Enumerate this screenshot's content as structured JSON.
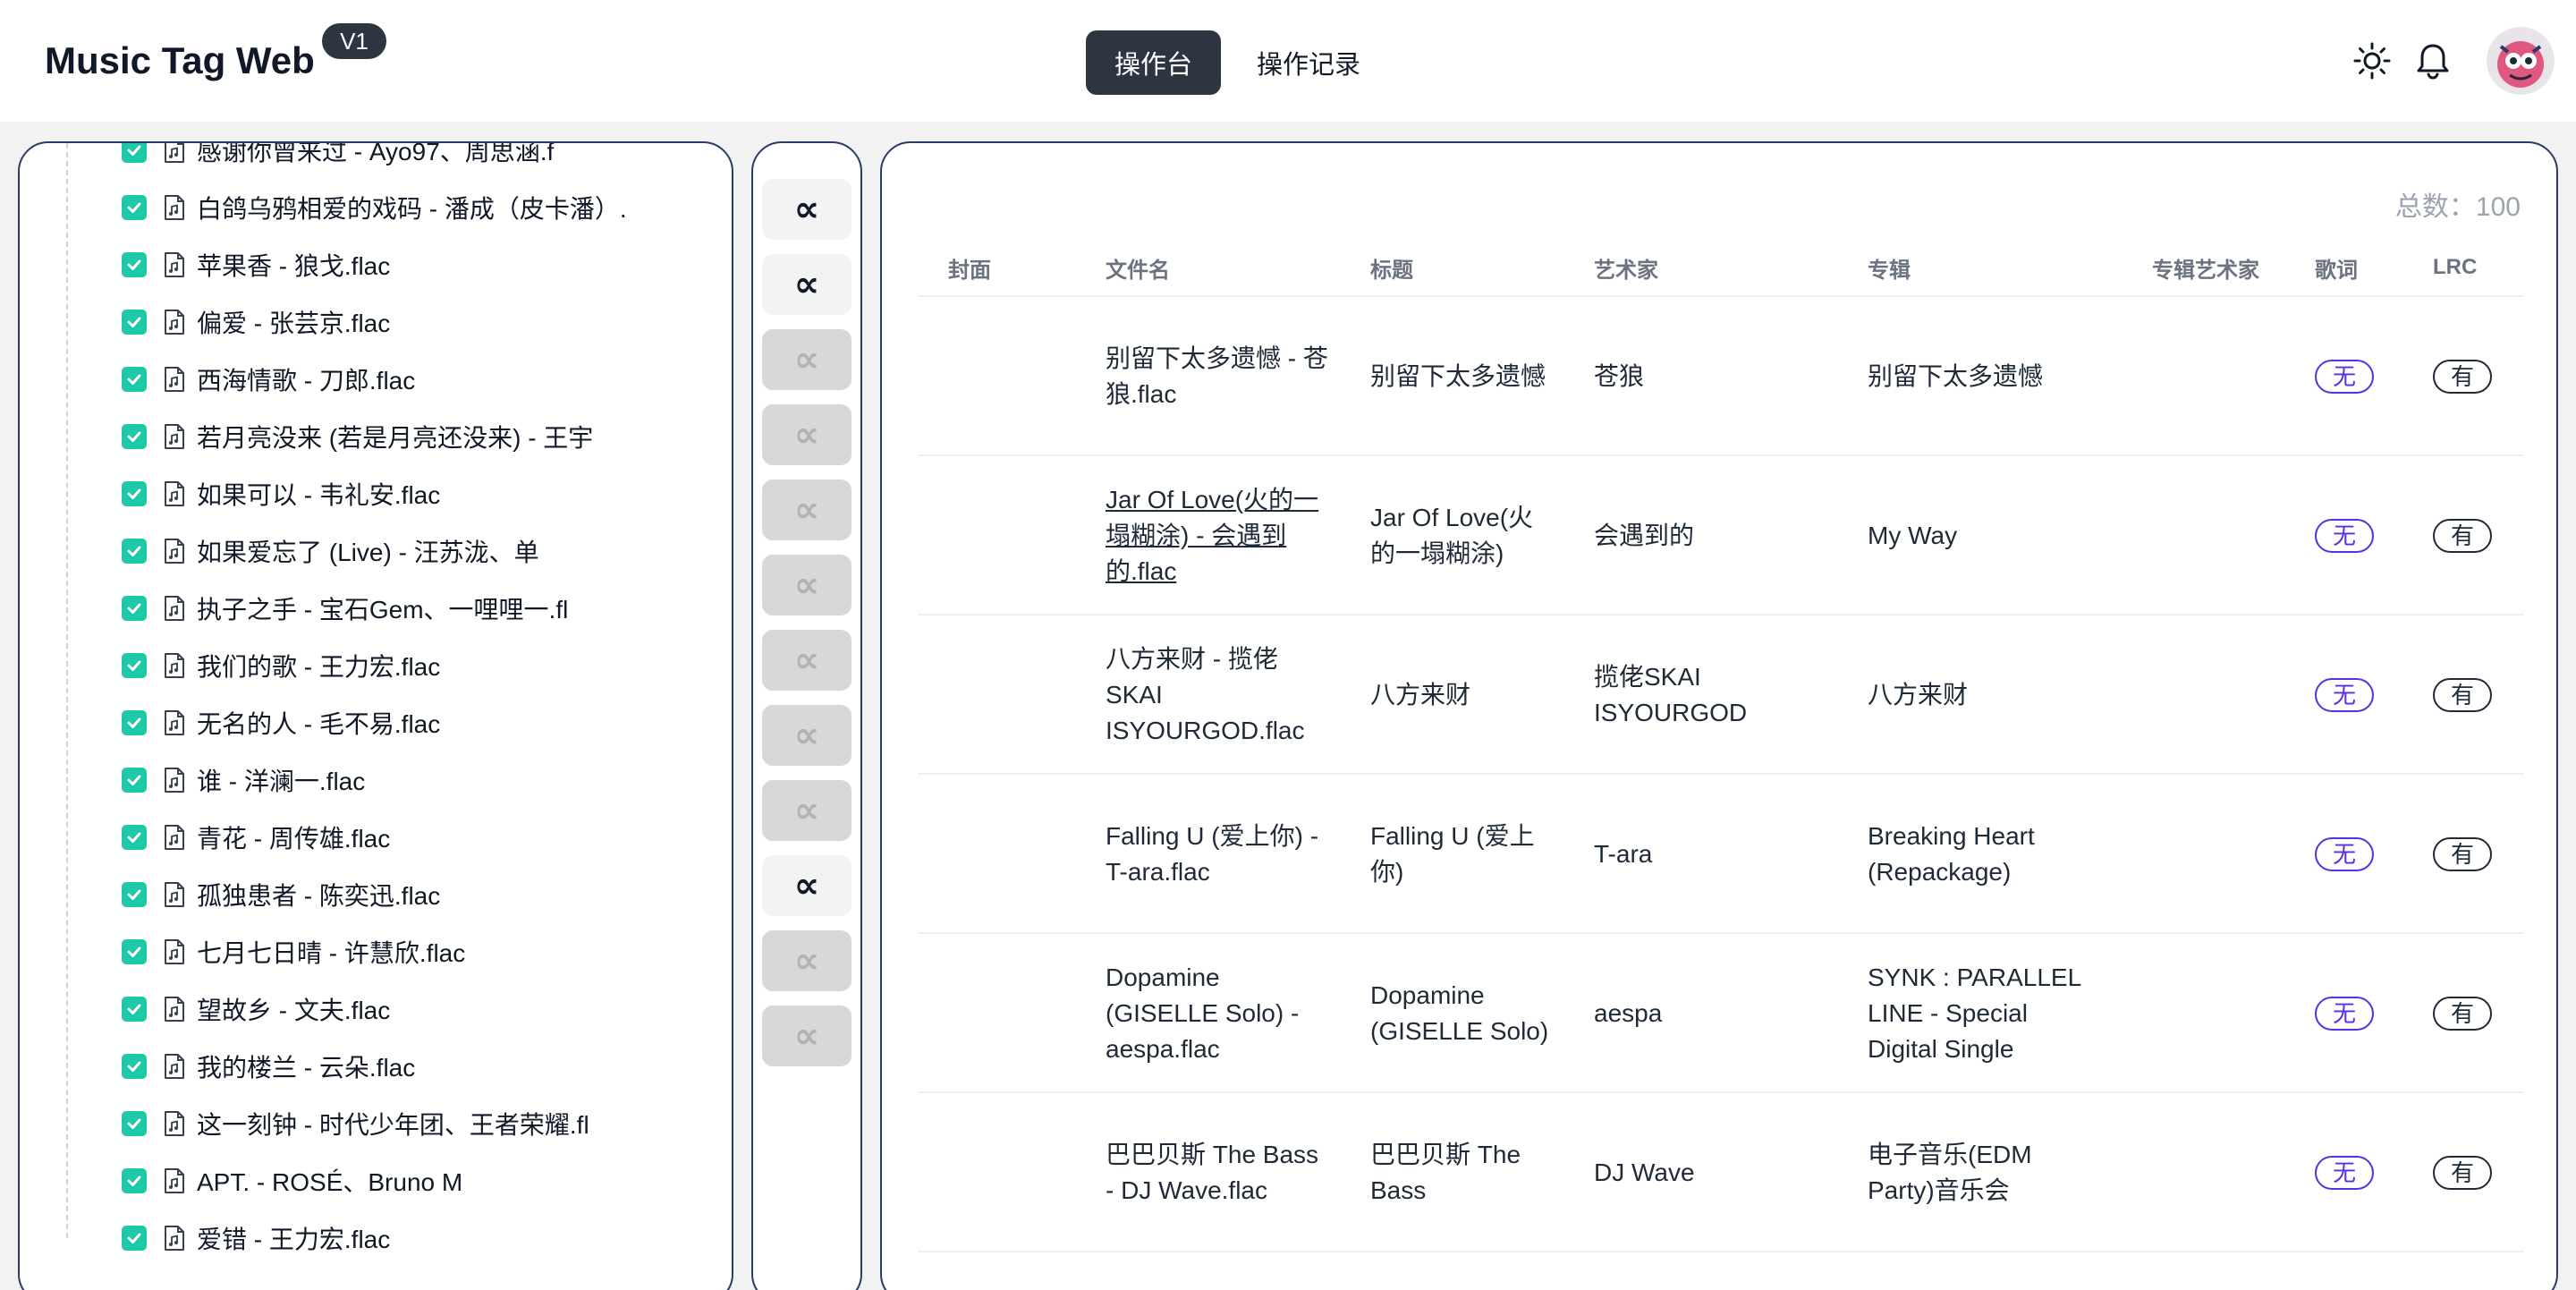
{
  "header": {
    "brand": "Music Tag Web",
    "version": "V1",
    "tabs": [
      {
        "label": "操作台",
        "active": true
      },
      {
        "label": "操作记录",
        "active": false
      }
    ]
  },
  "tree": {
    "items": [
      "感谢你曾来过 - Ayo97、周思涵.f",
      "白鸽乌鸦相爱的戏码 - 潘成（皮卡潘）.",
      "苹果香 - 狼戈.flac",
      "偏爱 - 张芸京.flac",
      "西海情歌 - 刀郎.flac",
      "若月亮没来 (若是月亮还没来) - 王宇",
      "如果可以 - 韦礼安.flac",
      "如果爱忘了 (Live) - 汪苏泷、单",
      "执子之手 - 宝石Gem、一哩哩一.fl",
      "我们的歌 - 王力宏.flac",
      "无名的人 - 毛不易.flac",
      "谁 - 洋澜一.flac",
      "青花 - 周传雄.flac",
      "孤独患者 - 陈奕迅.flac",
      "七月七日晴 - 许慧欣.flac",
      "望故乡 - 文夫.flac",
      "我的楼兰 - 云朵.flac",
      "这一刻钟 - 时代少年团、王者荣耀.fl",
      "APT. - ROSÉ、Bruno M",
      "爱错 - 王力宏.flac"
    ]
  },
  "actions": {
    "symbol": "∝",
    "states": [
      true,
      true,
      false,
      false,
      false,
      false,
      false,
      false,
      false,
      true,
      false,
      false
    ]
  },
  "table": {
    "total_label": "总数：100",
    "headers": {
      "cover": "封面",
      "filename": "文件名",
      "title": "标题",
      "artist": "艺术家",
      "album": "专辑",
      "album_artist": "专辑艺术家",
      "lyrics": "歌词",
      "lrc": "LRC"
    },
    "rows": [
      {
        "filename": "别留下太多遗憾 - 苍狼.flac",
        "title": "别留下太多遗憾",
        "artist": "苍狼",
        "album": "别留下太多遗憾",
        "lyrics": "无",
        "lrc": "有"
      },
      {
        "filename": "Jar Of Love(火的一塌糊涂) - 会遇到的.flac",
        "title": "Jar Of Love(火的一塌糊涂)",
        "artist": "会遇到的",
        "album": "My Way",
        "lyrics": "无",
        "lrc": "有"
      },
      {
        "filename": "八方来财 - 揽佬SKAI ISYOURGOD.flac",
        "title": "八方来财",
        "artist": "揽佬SKAI ISYOURGOD",
        "album": "八方来财",
        "lyrics": "无",
        "lrc": "有"
      },
      {
        "filename": "Falling U (爱上你) - T-ara.flac",
        "title": "Falling U (爱上你)",
        "artist": "T-ara",
        "album": "Breaking Heart (Repackage)",
        "lyrics": "无",
        "lrc": "有"
      },
      {
        "filename": "Dopamine (GISELLE Solo) - aespa.flac",
        "title": "Dopamine (GISELLE Solo)",
        "artist": "aespa",
        "album": "SYNK : PARALLEL LINE - Special Digital Single",
        "lyrics": "无",
        "lrc": "有"
      },
      {
        "filename": "巴巴贝斯 The Bass - DJ Wave.flac",
        "title": "巴巴贝斯 The Bass",
        "artist": "DJ Wave",
        "album": "电子音乐(EDM Party)音乐会",
        "lyrics": "无",
        "lrc": "有"
      }
    ]
  }
}
